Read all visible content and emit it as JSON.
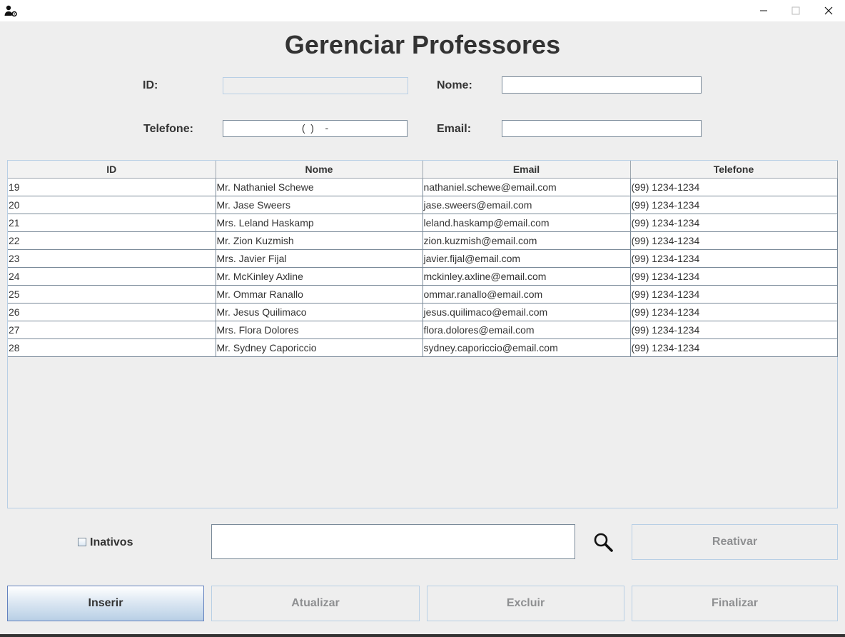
{
  "window": {
    "icon": "user-gear-icon",
    "controls": [
      "minimize-icon",
      "maximize-icon",
      "close-icon"
    ]
  },
  "heading": "Gerenciar Professores",
  "form": {
    "id_label": "ID:",
    "id_value": "",
    "nome_label": "Nome:",
    "nome_value": "",
    "telefone_label": "Telefone:",
    "telefone_value": "(  )    -",
    "email_label": "Email:",
    "email_value": ""
  },
  "table": {
    "columns": [
      "ID",
      "Nome",
      "Email",
      "Telefone"
    ],
    "rows": [
      [
        "19",
        "Mr. Nathaniel Schewe",
        "nathaniel.schewe@email.com",
        "(99) 1234-1234"
      ],
      [
        "20",
        "Mr. Jase Sweers",
        "jase.sweers@email.com",
        "(99) 1234-1234"
      ],
      [
        "21",
        "Mrs. Leland Haskamp",
        "leland.haskamp@email.com",
        "(99) 1234-1234"
      ],
      [
        "22",
        "Mr. Zion Kuzmish",
        "zion.kuzmish@email.com",
        "(99) 1234-1234"
      ],
      [
        "23",
        "Mrs. Javier Fijal",
        "javier.fijal@email.com",
        "(99) 1234-1234"
      ],
      [
        "24",
        "Mr. McKinley Axline",
        "mckinley.axline@email.com",
        "(99) 1234-1234"
      ],
      [
        "25",
        "Mr. Ommar Ranallo",
        "ommar.ranallo@email.com",
        "(99) 1234-1234"
      ],
      [
        "26",
        "Mr. Jesus Quilimaco",
        "jesus.quilimaco@email.com",
        "(99) 1234-1234"
      ],
      [
        "27",
        "Mrs. Flora Dolores",
        "flora.dolores@email.com",
        "(99) 1234-1234"
      ],
      [
        "28",
        "Mr. Sydney Caporiccio",
        "sydney.caporiccio@email.com",
        "(99) 1234-1234"
      ]
    ]
  },
  "filter": {
    "inativos_label": "Inativos",
    "inativos_checked": false,
    "search_value": "",
    "search_icon": "search-icon",
    "reativar_label": "Reativar"
  },
  "actions": {
    "inserir": "Inserir",
    "atualizar": "Atualizar",
    "excluir": "Excluir",
    "finalizar": "Finalizar"
  },
  "colors": {
    "primary_button_border": "#6382bf",
    "disabled_text": "#8e8f91",
    "background": "#eeeeee"
  }
}
